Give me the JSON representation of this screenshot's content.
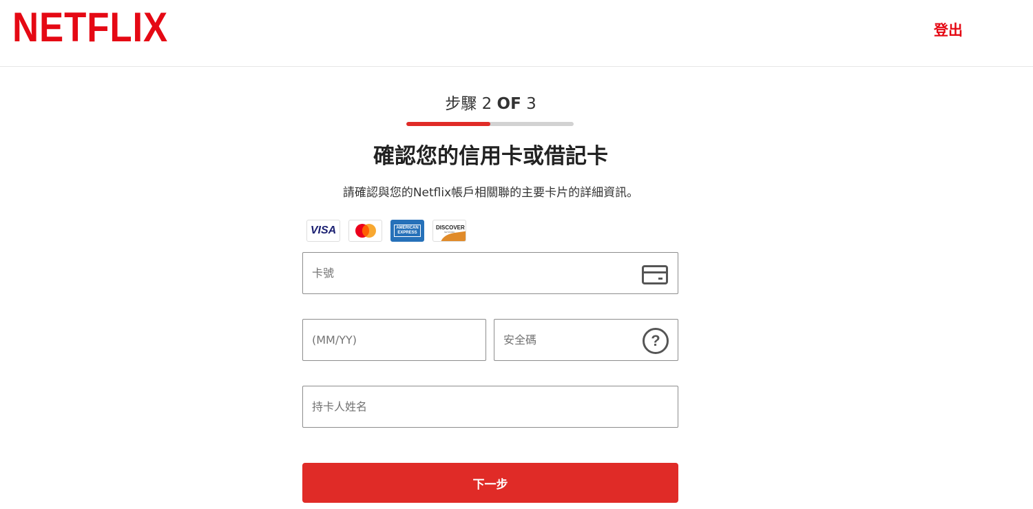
{
  "header": {
    "logo_text": "NETFLIX",
    "signout_label": "登出",
    "brand_color": "#e50914"
  },
  "step": {
    "prefix": "步驟",
    "current": "2",
    "of": "OF",
    "total": "3",
    "progress_fraction": 0.5
  },
  "title": "確認您的信用卡或借記卡",
  "subtitle": "請確認與您的Netflix帳戶相關聯的主要卡片的詳細資訊。",
  "card_logos": {
    "visa": "VISA",
    "amex_line1": "AMERICAN",
    "amex_line2": "EXPRESS",
    "discover": "DISCOVER",
    "discover_sub": "NETWORK"
  },
  "form": {
    "card_number_placeholder": "卡號",
    "expiry_placeholder": "(MM/YY)",
    "cvv_placeholder": "安全碼",
    "name_placeholder": "持卡人姓名",
    "card_icon": "credit-card-icon",
    "help_icon": "question-circle-icon",
    "help_glyph": "?"
  },
  "next_button_label": "下一步",
  "accent_color": "#e02b27"
}
